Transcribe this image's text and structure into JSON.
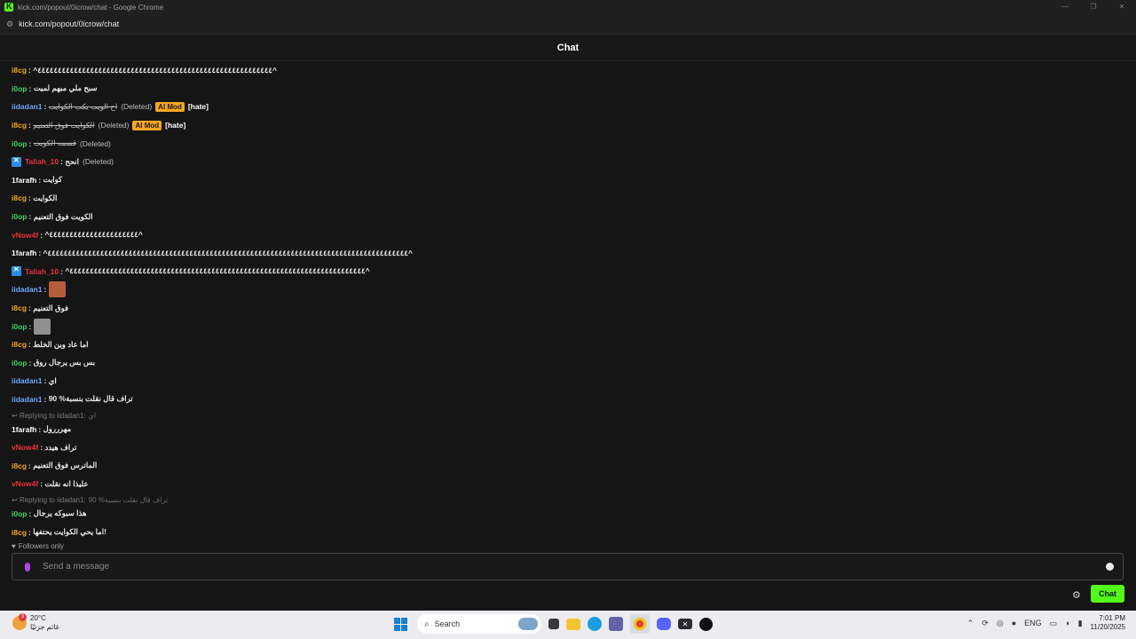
{
  "browser": {
    "window_title": "kick.com/popout/0icrow/chat - Google Chrome",
    "url": "kick.com/popout/0icrow/chat",
    "controls": [
      "—",
      "❐",
      "✕"
    ]
  },
  "chat": {
    "title": "Chat",
    "messages": [
      {
        "user": "i8cg",
        "color": "#f5a623",
        "text": "^٤٤٤٤٤٤٤٤٤٤٤٤٤٤٤٤٤٤٤٤٤٤٤٤٤٤٤٤٤٤٤٤٤٤٤٤٤٤٤٤٤٤٤٤٤٤٤٤٤٤٤٤٤٤٤٤٤٤^"
      },
      {
        "user": "i0op",
        "color": "#3ed16b",
        "text": "سبح ملي مبهم لميت"
      },
      {
        "user": "iidadan1",
        "color": "#6fa8ff",
        "deleted_text": "اح الويت يكب الكوايت",
        "deleted_label": "(Deleted)",
        "ai_mod": "AI Mod",
        "tag": "[hate]"
      },
      {
        "user": "i8cg",
        "color": "#f5a623",
        "deleted_text": "الكوايت فوق التعنيم",
        "deleted_label": "(Deleted)",
        "ai_mod": "AI Mod",
        "tag": "[hate]"
      },
      {
        "user": "i0op",
        "color": "#3ed16b",
        "deleted_text": "قسمه الكويت",
        "deleted_label": "(Deleted)"
      },
      {
        "user": "Taliah_10",
        "color": "#e8333d",
        "badge": "moderator-icon",
        "text": "انحح",
        "deleted_label": "(Deleted)"
      },
      {
        "user": "1farafh",
        "color": "#ffffff",
        "text": "كوايت"
      },
      {
        "user": "i8cg",
        "color": "#f5a623",
        "text": "الكوايت"
      },
      {
        "user": "i0op",
        "color": "#3ed16b",
        "text": "الكويت فوق التعنيم"
      },
      {
        "user": "vNow4f",
        "color": "#e8333d",
        "text": "^٤٤٤٤٤٤٤٤٤٤٤٤٤٤٤٤٤٤٤٤٤٤^"
      },
      {
        "user": "1farafh",
        "color": "#ffffff",
        "text": "^٤٤٤٤٤٤٤٤٤٤٤٤٤٤٤٤٤٤٤٤٤٤٤٤٤٤٤٤٤٤٤٤٤٤٤٤٤٤٤٤٤٤٤٤٤٤٤٤٤٤٤٤٤٤٤٤٤٤٤٤٤٤٤٤٤٤٤٤٤٤٤٤٤٤٤٤٤٤٤٤٤٤٤٤٤٤٤٤٤^"
      },
      {
        "user": "Taliah_10",
        "color": "#e8333d",
        "badge": "moderator-icon",
        "text": "^٤٤٤٤٤٤٤٤٤٤٤٤٤٤٤٤٤٤٤٤٤٤٤٤٤٤٤٤٤٤٤٤٤٤٤٤٤٤٤٤٤٤٤٤٤٤٤٤٤٤٤٤٤٤٤٤٤٤٤٤٤٤٤٤٤٤٤٤٤٤٤٤٤^"
      },
      {
        "user": "iidadan1",
        "color": "#6fa8ff",
        "emote": "face-emote"
      },
      {
        "user": "i8cg",
        "color": "#f5a623",
        "text": "فوق التعنيم"
      },
      {
        "user": "i0op",
        "color": "#3ed16b",
        "emote": "figure-emote"
      },
      {
        "user": "i8cg",
        "color": "#f5a623",
        "text": "اما عاد وين الخلط"
      },
      {
        "user": "i0op",
        "color": "#3ed16b",
        "text": "بس بس يرجال روق"
      },
      {
        "user": "iidadan1",
        "color": "#6fa8ff",
        "text": "اي"
      },
      {
        "user": "iidadan1",
        "color": "#6fa8ff",
        "text": "90 %تراف قال نقلت بنسبة"
      },
      {
        "reply_label": "Replying to iidadan1:",
        "reply_text": "اي",
        "user": "1farafh",
        "color": "#ffffff",
        "text": "مهرررول"
      },
      {
        "user": "vNow4f",
        "color": "#e8333d",
        "text": "تراف هيدد"
      },
      {
        "user": "i8cg",
        "color": "#f5a623",
        "text": "الماترس فوق التعنيم"
      },
      {
        "user": "vNow4f",
        "color": "#e8333d",
        "text": "عليذا انه نقلت"
      },
      {
        "reply_label": "Replying to iidadan1:",
        "reply_text": "90 %تراف قال نقلت بنسبة",
        "user": "i0op",
        "color": "#3ed16b",
        "text": "هذا سبوكه يرجال"
      },
      {
        "user": "i8cg",
        "color": "#f5a623",
        "text": "اما يحي الكوايت يحتفها!"
      }
    ],
    "followers_only": "Followers only",
    "input_placeholder": "Send a message",
    "send_button": "Chat"
  },
  "taskbar": {
    "weather_badge": "3",
    "temperature": "20°C",
    "weather_desc": "غائم جزئيًا",
    "search_label": "Search",
    "lang": "ENG",
    "time": "7:01 PM",
    "date": "11/20/2025",
    "accent": "#1a7fd4"
  }
}
